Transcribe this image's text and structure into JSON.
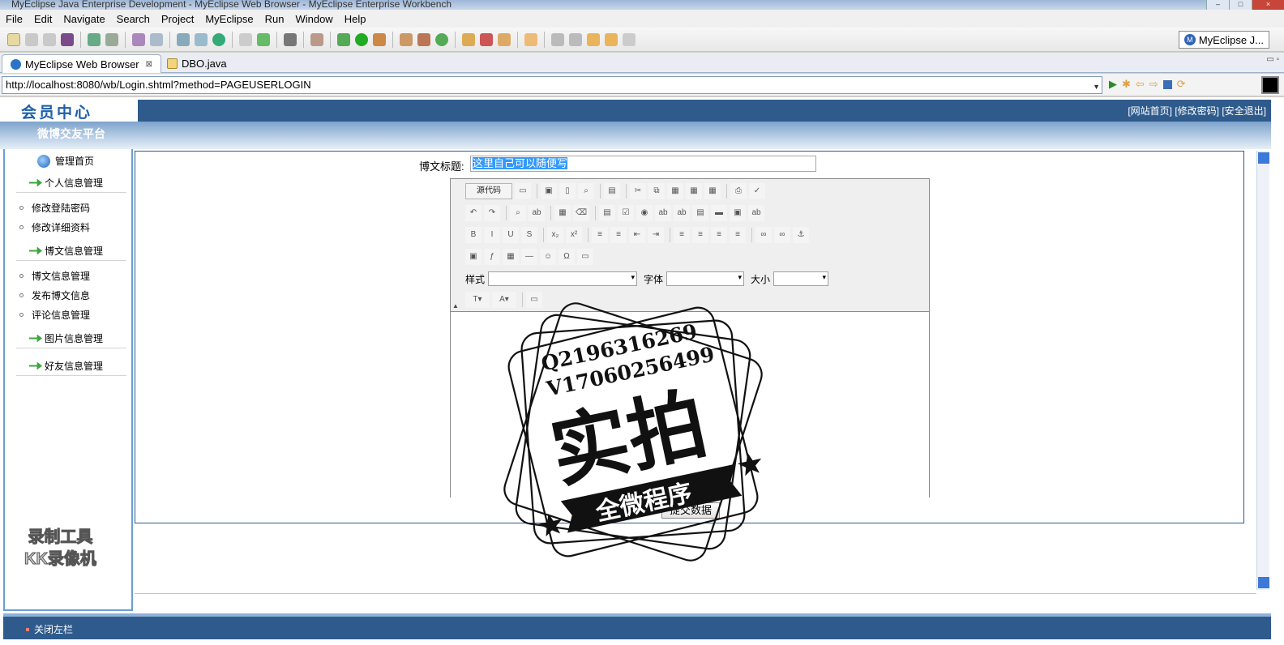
{
  "window": {
    "title": "MyEclipse Java Enterprise Development - MyEclipse Web Browser - MyEclipse Enterprise Workbench"
  },
  "menu": [
    "File",
    "Edit",
    "Navigate",
    "Search",
    "Project",
    "MyEclipse",
    "Run",
    "Window",
    "Help"
  ],
  "perspective": {
    "label": "MyEclipse J..."
  },
  "tabs": [
    {
      "label": "MyEclipse Web Browser",
      "close": "⊠"
    },
    {
      "label": "DBO.java"
    }
  ],
  "browser": {
    "url": "http://localhost:8080/wb/Login.shtml?method=PAGEUSERLOGIN"
  },
  "page": {
    "logo": "会员中心",
    "subtitle": "微博交友平台",
    "toplinks": "[网站首页]  [修改密码]  [安全退出]",
    "sidebar": {
      "home": "管理首页",
      "sections": [
        {
          "label": "个人信息管理",
          "links": [
            "修改登陆密码",
            "修改详细资料"
          ]
        },
        {
          "label": "博文信息管理",
          "links": [
            "博文信息管理",
            "发布博文信息",
            "评论信息管理"
          ]
        },
        {
          "label": "图片信息管理",
          "links": []
        },
        {
          "label": "好友信息管理",
          "links": []
        }
      ]
    },
    "form": {
      "title_label": "博文标题:",
      "title_value": "这里自己可以随便写",
      "source_button": "源代码",
      "style_label": "样式",
      "font_label": "字体",
      "size_label": "大小",
      "submit": "提交数据"
    },
    "bottom": {
      "close_left": "关闭左栏"
    }
  },
  "watermark": {
    "qq": "Q2196316269",
    "vx": "V17060256499",
    "big": "实拍",
    "banner": "全微程序",
    "recorder": [
      "录制工具",
      "KK录像机"
    ]
  }
}
